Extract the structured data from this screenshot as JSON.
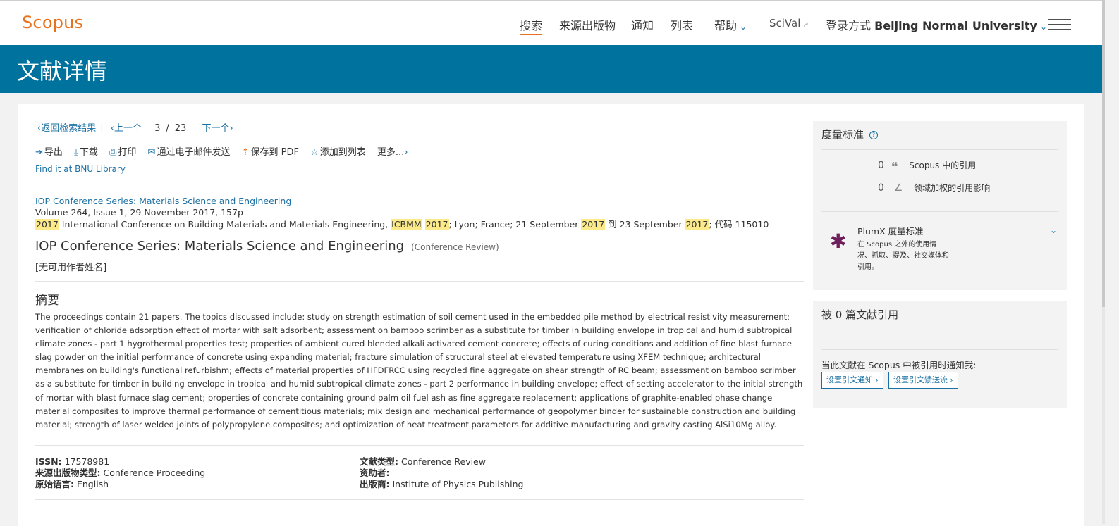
{
  "header": {
    "logo": "Scopus",
    "nav": {
      "search": "搜索",
      "sources": "来源出版物",
      "alerts": "通知",
      "lists": "列表",
      "help": "帮助",
      "scival": "SciVal",
      "login_prefix": "登录方式",
      "institution": "Beijing Normal University"
    }
  },
  "page_title": "文献详情",
  "pager": {
    "back": "返回检索结果",
    "prev": "上一个",
    "current": "3",
    "slash": "/",
    "total": "23",
    "next": "下一个"
  },
  "actions": {
    "export": "导出",
    "download": "下载",
    "print": "打印",
    "email": "通过电子邮件发送",
    "save_pdf": "保存到 PDF",
    "add_list": "添加到列表",
    "more": "更多..."
  },
  "find_library": "Find it at BNU Library",
  "source": {
    "series_link": "IOP Conference Series: Materials Science and Engineering",
    "volume_line": "Volume 264, Issue 1, 29 November 2017, 157p",
    "conf": {
      "y1": "2017",
      "t1": " International Conference on Building Materials and Materials Engineering, ",
      "acr": "ICBMM",
      "y2": "2017",
      "t2": "; Lyon; France; 21 September ",
      "y3": "2017",
      "t3": " 到 23 September ",
      "y4": "2017",
      "t4": "; 代码 115010"
    }
  },
  "document": {
    "title": "IOP Conference Series: Materials Science and Engineering",
    "type": "(Conference Review)",
    "authors": "[无可用作者姓名]"
  },
  "abstract": {
    "heading": "摘要",
    "text": "The proceedings contain 21 papers. The topics discussed include: study on strength estimation of soil cement used in the embedded pile method by electrical resistivity measurement; verification of chloride adsorption effect of mortar with salt adsorbent; assessment on bamboo scrimber as a substitute for timber in building envelope in tropical and humid subtropical climate zones - part 1 hygrothermal properties test; properties of ambient cured blended alkali activated cement concrete; effects of curing conditions and addition of fine blast furnace slag powder on the initial performance of concrete using expanding material; fracture simulation of structural steel at elevated temperature using XFEM technique; architectural membranes on building's functional refurbishm; effects of material properties of HFDFRCC using recycled fine aggregate on shear strength of RC beam; assessment on bamboo scrimber as a substitute for timber in building envelope in tropical and humid subtropical climate zones - part 2 performance in building envelope; effect of setting accelerator to the initial strength of mortar with blast furnace slag cement; properties of concrete containing ground palm oil fuel ash as fine aggregate replacement; applications of graphite-enabled phase change material composites to improve thermal performance of cementitious materials; mix design and mechanical performance of geopolymer binder for sustainable construction and building material; strength of laser welded joints of polypropylene composites; and optimization of heat treatment parameters for additive manufacturing and gravity casting AlSi10Mg alloy."
  },
  "meta": {
    "issn_label": "ISSN:",
    "issn": " 17578981",
    "srctype_label": "来源出版物类型:",
    "srctype": " Conference Proceeding",
    "lang_label": "原始语言:",
    "lang": " English",
    "doctype_label": "文献类型:",
    "doctype": " Conference Review",
    "sponsor_label": "资助者:",
    "publisher_label": "出版商:",
    "publisher": " Institute of Physics Publishing"
  },
  "metrics": {
    "heading": "度量标准",
    "help": "?",
    "citations_count": "0",
    "citations_label": "Scopus 中的引用",
    "fwci_count": "0",
    "fwci_label": "领域加权的引用影响",
    "plumx_title": "PlumX 度量标准",
    "plumx_desc": "在 Scopus 之外的使用情况、抓取、提及、社交媒体和引用。"
  },
  "cited_by": {
    "heading": "被 0 篇文献引用",
    "notify": "当此文献在 Scopus 中被引用时通知我:",
    "btn_alert": "设置引文通知 ›",
    "btn_feed": "设置引文馈送流 ›"
  },
  "icons": {
    "nav_chevron": "chevron-down-icon",
    "external": "external-link-icon",
    "menu": "hamburger-menu-icon",
    "quote": "quote-icon",
    "plumx": "plumx-icon"
  },
  "colors": {
    "brand_orange": "#e9711c",
    "band_blue": "#00729e",
    "link_blue": "#1a6fa3",
    "highlight": "#fbe98a"
  }
}
